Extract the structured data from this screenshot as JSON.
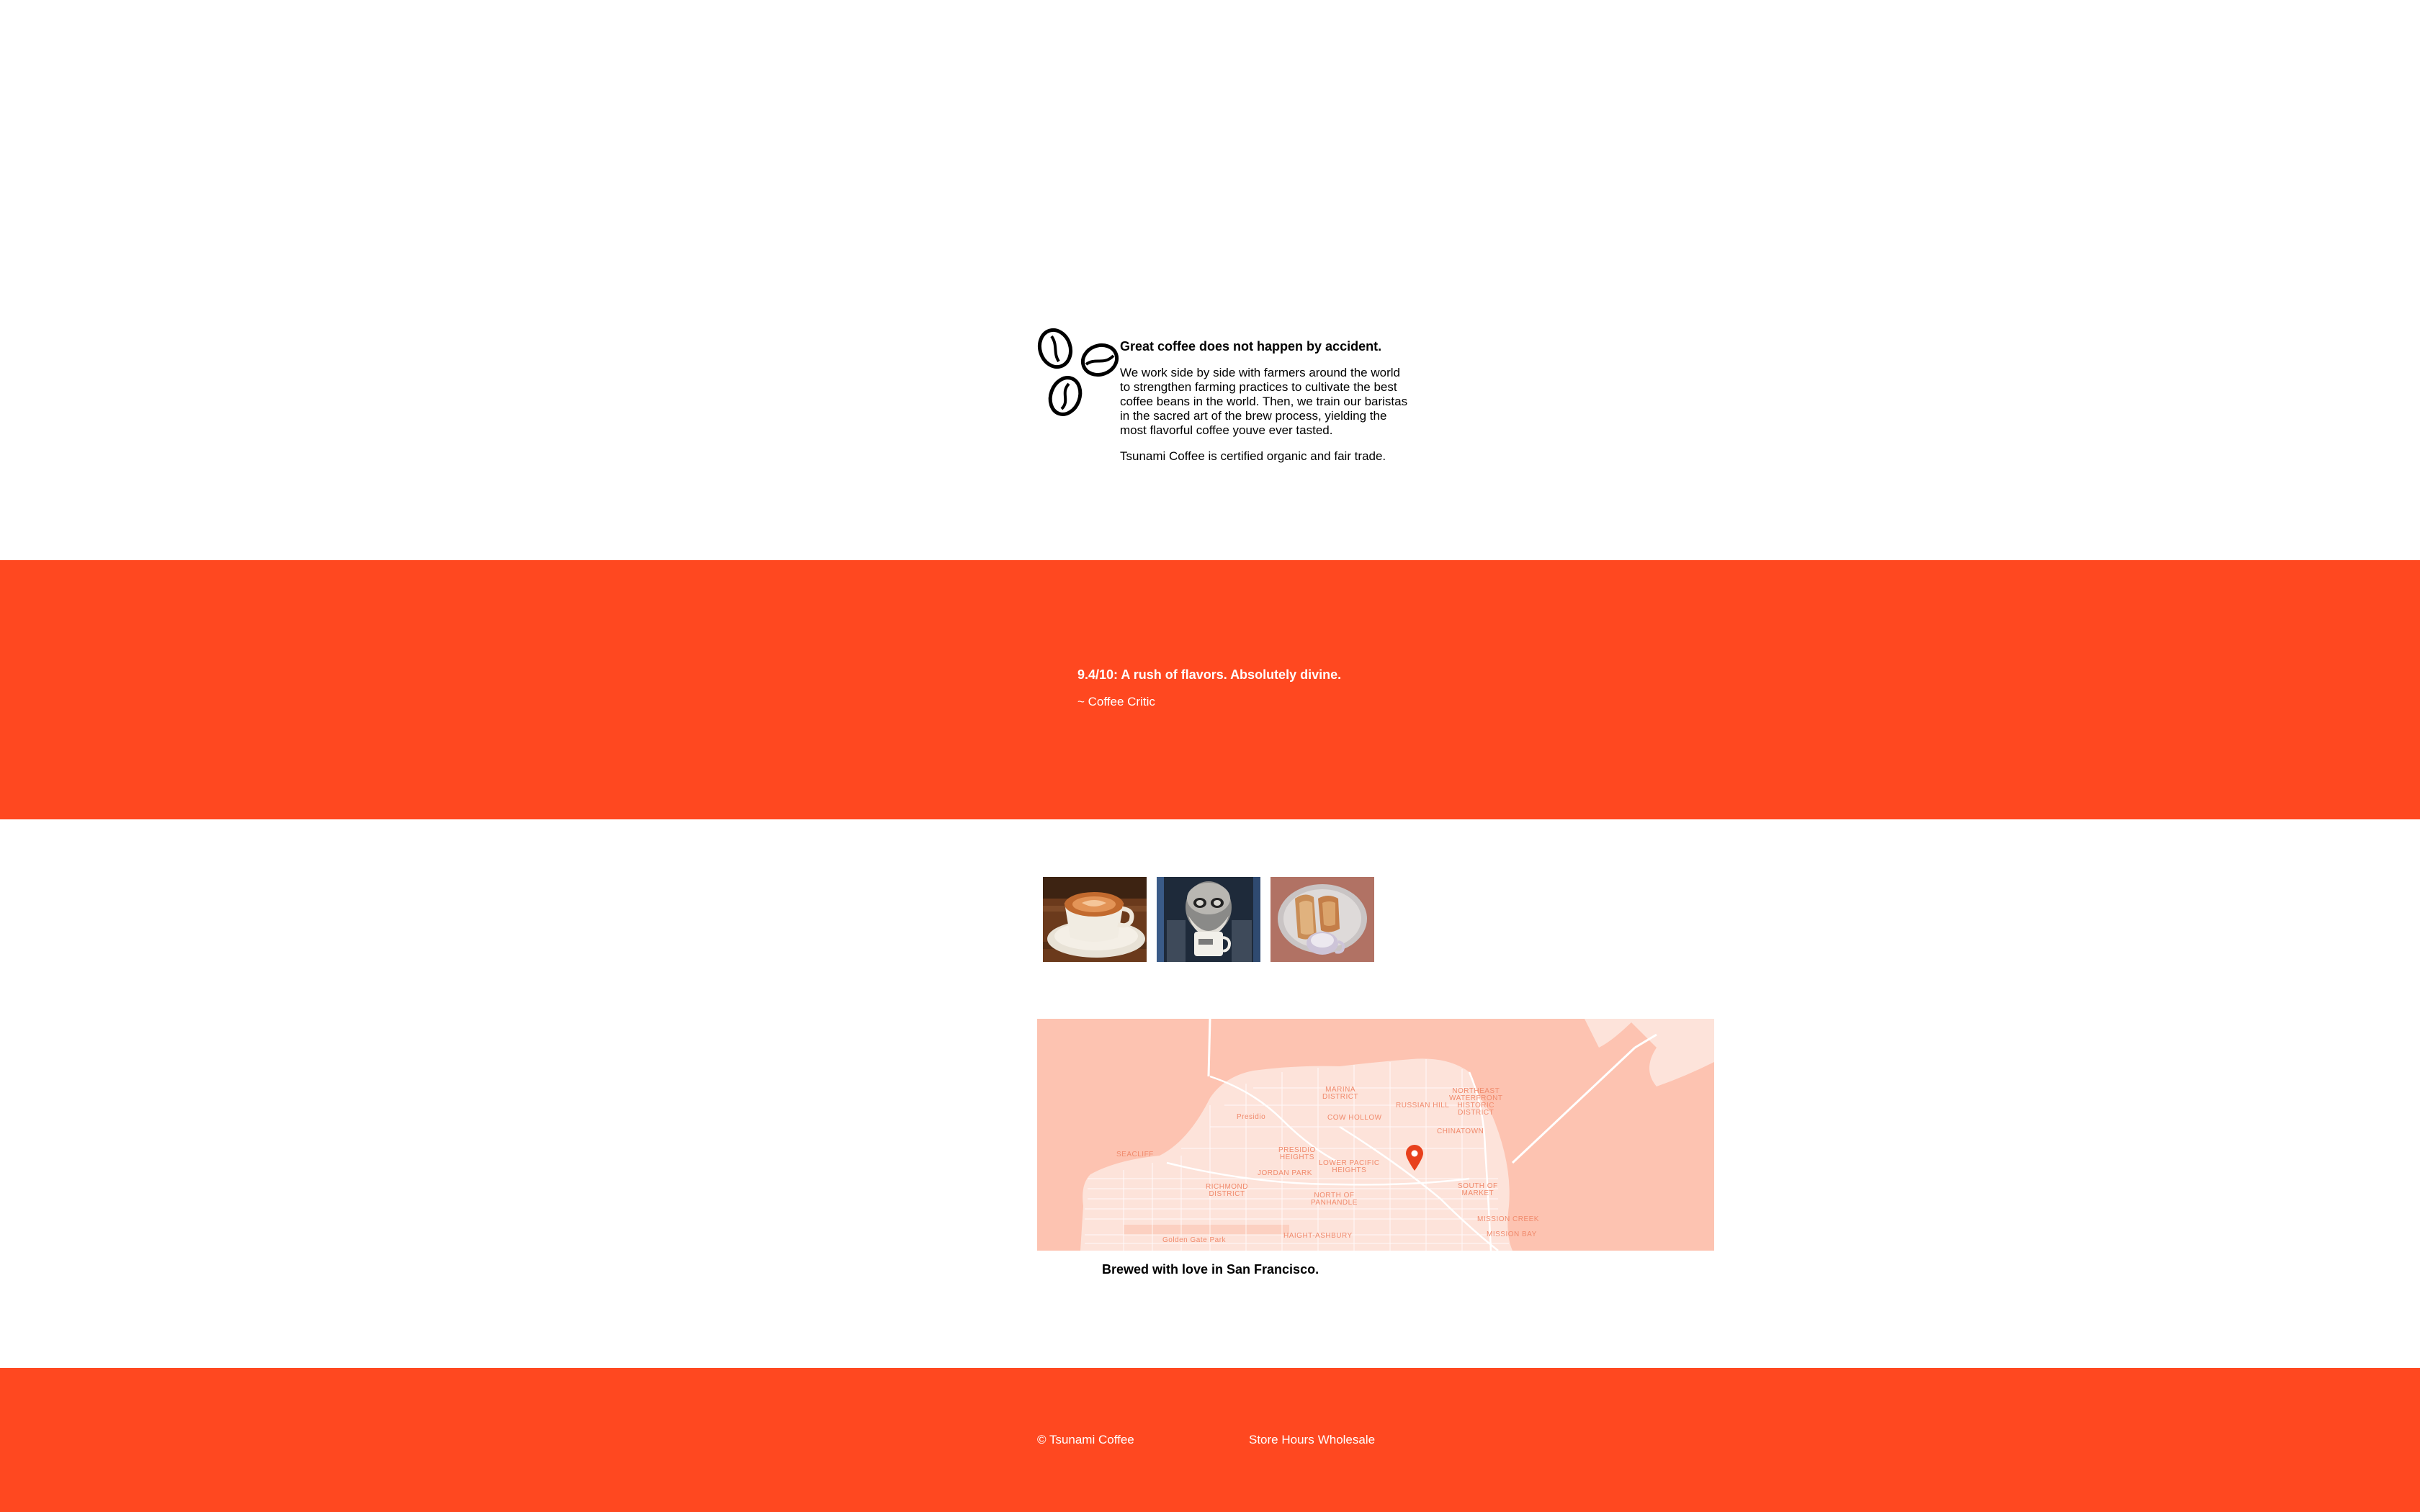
{
  "intro": {
    "heading": "Great coffee does not happen by accident.",
    "paragraph1": "We work side by side with farmers around the world to strengthen farming practices to cultivate the best coffee beans in the world. Then, we train our baristas in the sacred art of the brew process, yielding the most flavorful coffee youve ever tasted.",
    "paragraph2": "Tsunami Coffee is certified organic and fair trade."
  },
  "review": {
    "quote": "9.4/10: A rush of flavors. Absolutely divine.",
    "author": "~ Coffee Critic"
  },
  "gallery": {
    "images": [
      "latte-photo",
      "coffee-drinker-photo",
      "pastry-and-coffee-photo"
    ]
  },
  "map": {
    "labels": {
      "marina": "MARINA\nDISTRICT",
      "presidio": "Presidio",
      "cow_hollow": "COW HOLLOW",
      "russian_hill": "RUSSIAN HILL",
      "northeast": "NORTHEAST\nWATERFRONT\nHISTORIC\nDISTRICT",
      "chinatown": "CHINATOWN",
      "seacliff": "SEACLIFF",
      "presidio_heights": "PRESIDIO\nHEIGHTS",
      "lower_pacific": "LOWER PACIFIC\nHEIGHTS",
      "jordan_park": "JORDAN PARK",
      "richmond": "RICHMOND\nDISTRICT",
      "north_panhandle": "NORTH OF\nPANHANDLE",
      "south_market": "SOUTH OF\nMARKET",
      "mission_creek": "MISSION CREEK",
      "golden_gate_park": "Golden Gate Park",
      "haight": "HAIGHT-ASHBURY",
      "mission_bay": "MISSION BAY"
    }
  },
  "tagline": "Brewed with love in San Francisco.",
  "footer": {
    "copyright": "© Tsunami Coffee",
    "links": [
      "Store Hours",
      "Wholesale"
    ]
  },
  "colors": {
    "accent": "#ff4820",
    "map_bg": "#fdc3b1",
    "map_land": "#fde3da"
  }
}
